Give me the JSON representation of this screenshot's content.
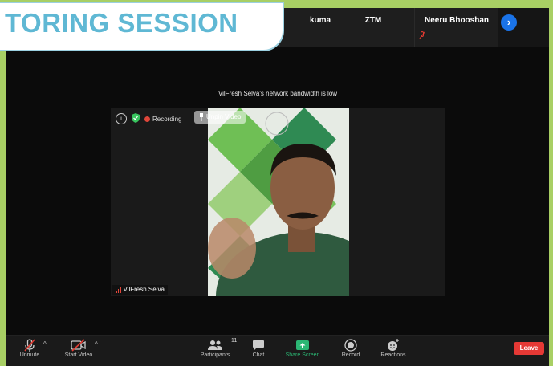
{
  "banner": {
    "title": "TORING SESSION"
  },
  "participants_strip": {
    "tiles": [
      {
        "name": "kumar",
        "muted": false
      },
      {
        "name": "ZTM",
        "muted": false
      },
      {
        "name": "Neeru Bhooshan",
        "muted": true
      }
    ]
  },
  "notice": "VilFresh Selva's network bandwidth is low",
  "video": {
    "recording_label": "Recording",
    "unpin_label": "Unpin Video",
    "speaker_name": "VilFresh Selva"
  },
  "toolbar": {
    "unmute": "Unmute",
    "start_video": "Start Video",
    "participants": "Participants",
    "participants_count": "11",
    "chat": "Chat",
    "share_screen": "Share Screen",
    "record": "Record",
    "reactions": "Reactions",
    "leave": "Leave"
  },
  "colors": {
    "share_green": "#2bb673",
    "leave_red": "#e53935",
    "accent_blue": "#1a73e8"
  }
}
